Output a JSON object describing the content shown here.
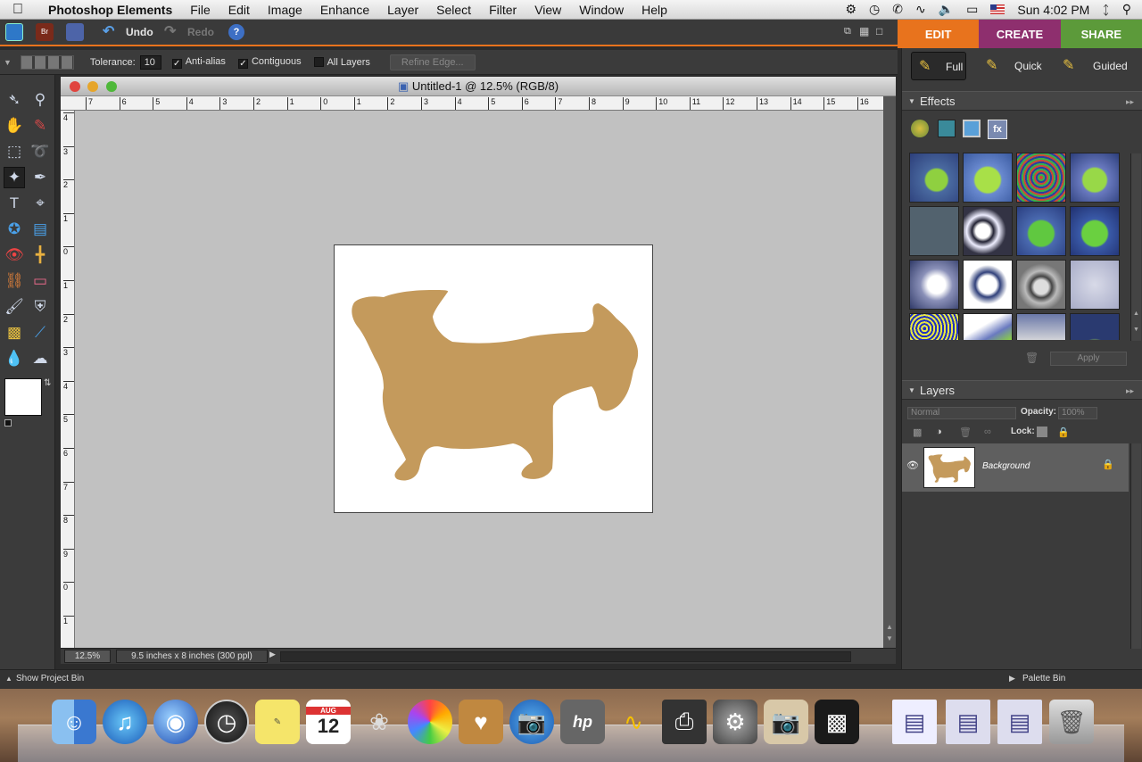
{
  "menubar": {
    "app_name": "Photoshop Elements",
    "items": [
      "File",
      "Edit",
      "Image",
      "Enhance",
      "Layer",
      "Select",
      "Filter",
      "View",
      "Window",
      "Help"
    ],
    "clock": "Sun 4:02 PM"
  },
  "appbar": {
    "undo_label": "Undo",
    "redo_label": "Redo",
    "help_symbol": "?"
  },
  "mode_tabs": {
    "edit": "EDIT",
    "create": "CREATE",
    "share": "SHARE",
    "colors": {
      "edit": "#e8731d",
      "create": "#8e2f6e",
      "share": "#5c9a3a"
    }
  },
  "options_bar": {
    "tolerance_label": "Tolerance:",
    "tolerance_value": "10",
    "anti_alias_label": "Anti-alias",
    "contiguous_label": "Contiguous",
    "all_layers_label": "All Layers",
    "refine_edge_label": "Refine Edge..."
  },
  "document": {
    "title": "Untitled-1 @ 12.5% (RGB/8)",
    "zoom": "12.5%",
    "size_info": "9.5 inches x 8 inches (300 ppl)",
    "hruler_labels": [
      "7",
      "6",
      "5",
      "4",
      "3",
      "2",
      "1",
      "0",
      "1",
      "2",
      "3",
      "4",
      "5",
      "6",
      "7",
      "8",
      "9",
      "10",
      "11",
      "12",
      "13",
      "14",
      "15",
      "16"
    ],
    "vruler_labels": [
      "4",
      "3",
      "2",
      "1",
      "0",
      "1",
      "2",
      "3",
      "4",
      "5",
      "6",
      "7",
      "8",
      "9",
      "0",
      "1"
    ],
    "silhouette_color": "#c49a5c"
  },
  "edit_modes": {
    "full": "Full",
    "quick": "Quick",
    "guided": "Guided"
  },
  "effects": {
    "title": "Effects",
    "apply_label": "Apply"
  },
  "layers": {
    "title": "Layers",
    "blend_mode": "Normal",
    "opacity_label": "Opacity:",
    "opacity_value": "100%",
    "lock_label": "Lock:",
    "layer_name": "Background"
  },
  "bottom": {
    "show_project_bin": "Show Project Bin",
    "palette_bin": "Palette Bin"
  },
  "dock": {
    "calendar_month": "AUG",
    "calendar_day": "12",
    "hp_label": "hp"
  }
}
